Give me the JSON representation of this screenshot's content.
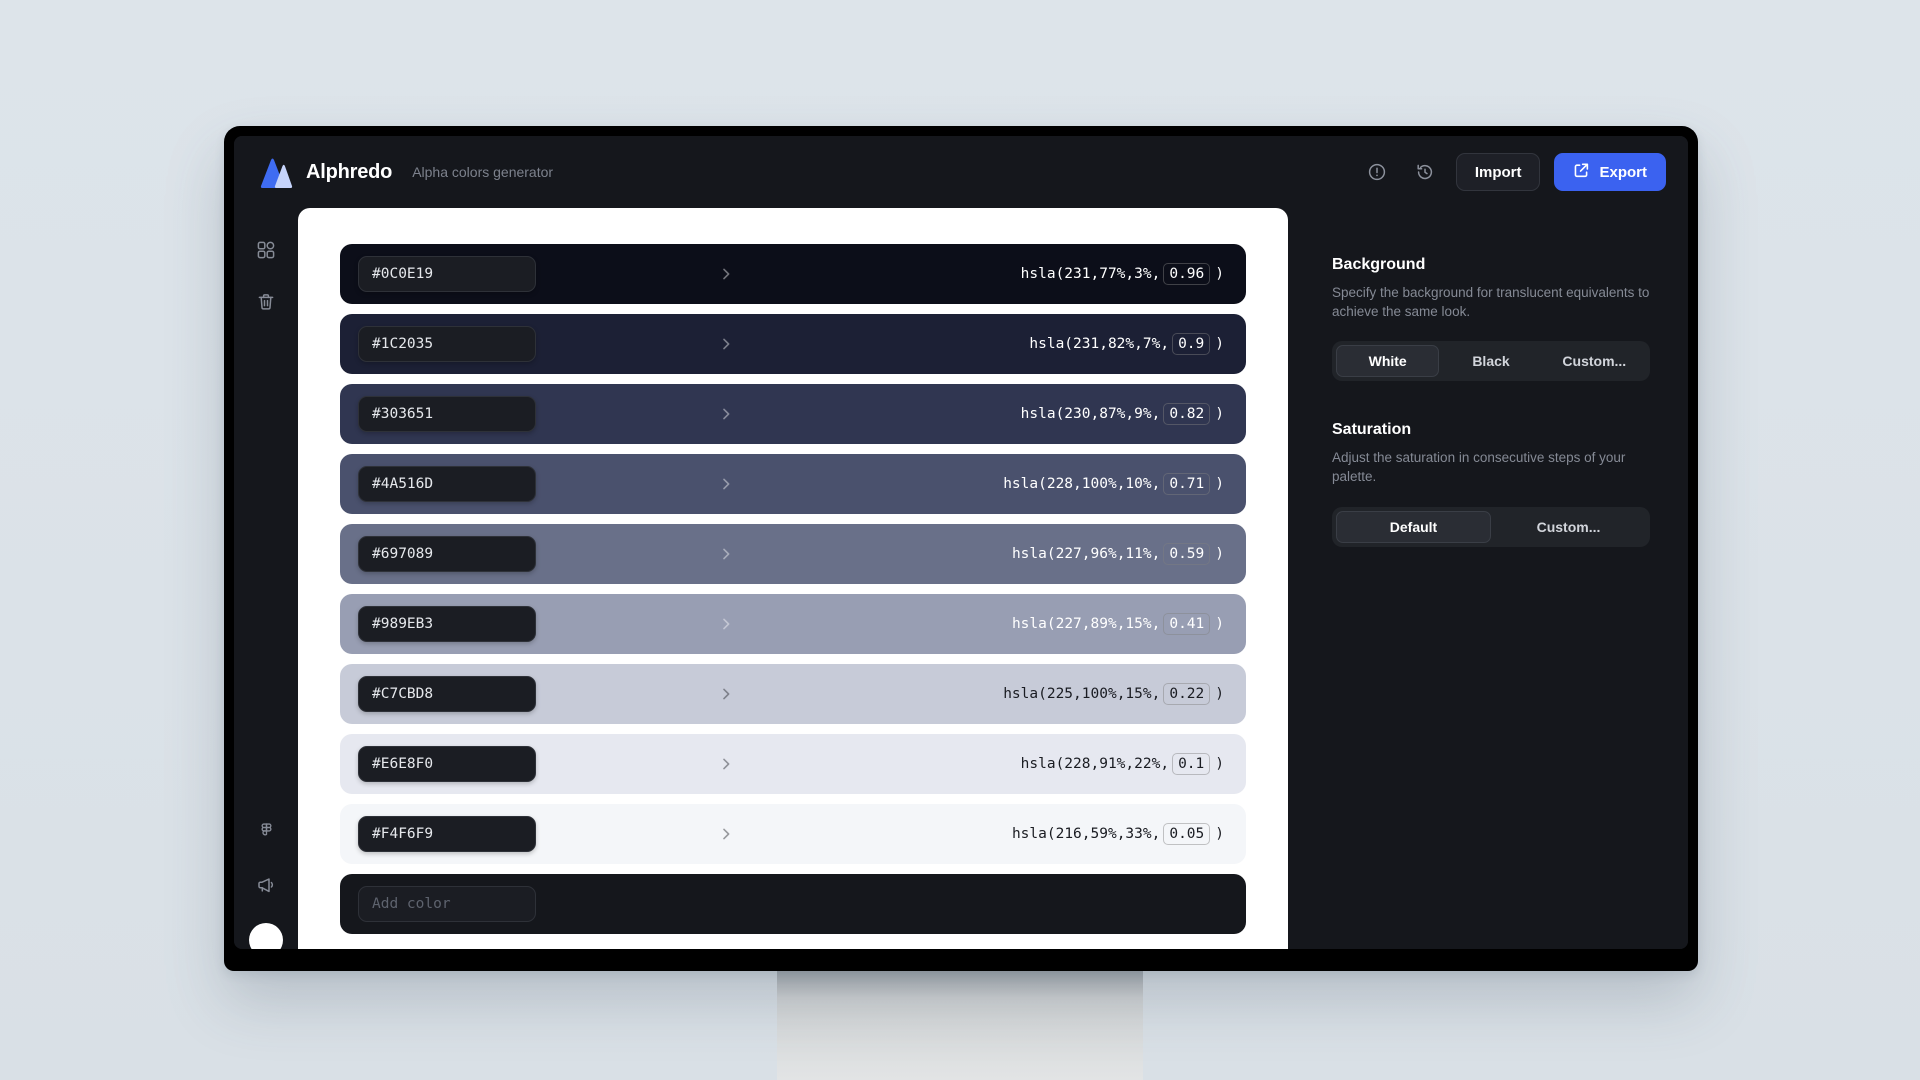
{
  "app": {
    "brand_name": "Alphredo",
    "brand_subtitle": "Alpha colors generator",
    "accent_color": "#3b62f0",
    "screen_bg": "#15171c",
    "canvas_bg": "#ffffff",
    "page_bg": "#dde4e9"
  },
  "topbar": {
    "info_icon": "info-circle-icon",
    "history_icon": "history-revert-icon",
    "import_label": "Import",
    "export_label": "Export",
    "export_icon": "share-export-icon"
  },
  "rail": {
    "items": [
      {
        "icon": "components-icon",
        "name": "components"
      },
      {
        "icon": "trash-icon",
        "name": "trash"
      }
    ],
    "bottom_items": [
      {
        "icon": "figma-icon",
        "name": "figma"
      },
      {
        "icon": "megaphone-icon",
        "name": "announcements"
      }
    ]
  },
  "swatches": [
    {
      "hex": "#0C0E19",
      "bg": "#0C0E19",
      "text_color": "#ffffff",
      "hsla_prefix": "hsla(231,77%,3%,",
      "alpha": "0.96",
      "hsla_suffix": ")"
    },
    {
      "hex": "#1C2035",
      "bg": "#1C2035",
      "text_color": "#ffffff",
      "hsla_prefix": "hsla(231,82%,7%,",
      "alpha": "0.9",
      "hsla_suffix": ")"
    },
    {
      "hex": "#303651",
      "bg": "#303651",
      "text_color": "#ffffff",
      "hsla_prefix": "hsla(230,87%,9%,",
      "alpha": "0.82",
      "hsla_suffix": ")"
    },
    {
      "hex": "#4A516D",
      "bg": "#4A516D",
      "text_color": "#ffffff",
      "hsla_prefix": "hsla(228,100%,10%,",
      "alpha": "0.71",
      "hsla_suffix": ")"
    },
    {
      "hex": "#697089",
      "bg": "#697089",
      "text_color": "#ffffff",
      "hsla_prefix": "hsla(227,96%,11%,",
      "alpha": "0.59",
      "hsla_suffix": ")"
    },
    {
      "hex": "#989EB3",
      "bg": "#989EB3",
      "text_color": "#ffffff",
      "hsla_prefix": "hsla(227,89%,15%,",
      "alpha": "0.41",
      "hsla_suffix": ")"
    },
    {
      "hex": "#C7CBD8",
      "bg": "#C7CBD8",
      "text_color": "#1a1c22",
      "hsla_prefix": "hsla(225,100%,15%,",
      "alpha": "0.22",
      "hsla_suffix": ")"
    },
    {
      "hex": "#E6E8F0",
      "bg": "#E6E8F0",
      "text_color": "#1a1c22",
      "hsla_prefix": "hsla(228,91%,22%,",
      "alpha": "0.1",
      "hsla_suffix": ")"
    },
    {
      "hex": "#F4F6F9",
      "bg": "#F4F6F9",
      "text_color": "#1a1c22",
      "hsla_prefix": "hsla(216,59%,33%,",
      "alpha": "0.05",
      "hsla_suffix": ")"
    }
  ],
  "add_color": {
    "label": "Add color"
  },
  "sidepanel": {
    "background": {
      "title": "Background",
      "description": "Specify the background for translucent equivalents to achieve the same look.",
      "options": [
        "White",
        "Black",
        "Custom..."
      ],
      "selected": "White"
    },
    "saturation": {
      "title": "Saturation",
      "description": "Adjust the saturation in consecutive steps of your palette.",
      "options": [
        "Default",
        "Custom..."
      ],
      "selected": "Default"
    }
  }
}
